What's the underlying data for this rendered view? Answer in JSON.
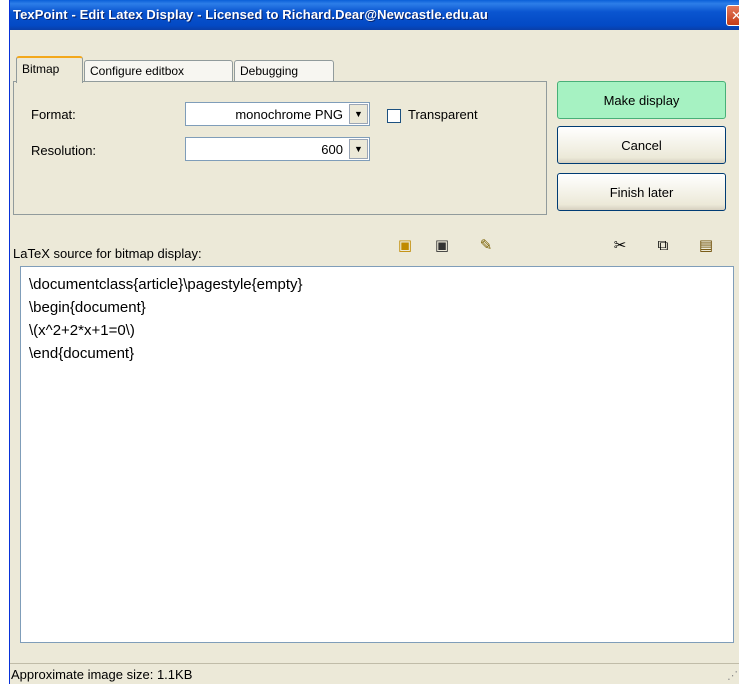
{
  "window": {
    "title": "TexPoint - Edit Latex Display  - Licensed to Richard.Dear@Newcastle.edu.au",
    "close_glyph": "✕"
  },
  "tabs": [
    {
      "label": "Bitmap",
      "active": true
    },
    {
      "label": "Configure editbox",
      "active": false
    },
    {
      "label": "Debugging",
      "active": false
    }
  ],
  "form": {
    "format_label": "Format:",
    "format_value": "monochrome PNG",
    "transparent_label": "Transparent",
    "transparent_checked": false,
    "resolution_label": "Resolution:",
    "resolution_value": "600"
  },
  "buttons": {
    "make_display": "Make display",
    "cancel": "Cancel",
    "finish_later": "Finish later"
  },
  "source": {
    "label": "LaTeX source for bitmap display:",
    "lines": [
      "\\documentclass{article}\\pagestyle{empty}",
      "\\begin{document}",
      "\\(x^2+2*x+1=0\\)",
      "\\end{document}"
    ]
  },
  "toolbar_icons": [
    "load-icon",
    "save-icon",
    "edit-icon",
    "cut-icon",
    "copy-icon",
    "paste-icon"
  ],
  "status": {
    "text": "Approximate image size: 1.1KB"
  },
  "colors": {
    "titlebar": "#0a55d0",
    "primary_button": "#a6f2c2",
    "window_bg": "#ece9d8"
  }
}
